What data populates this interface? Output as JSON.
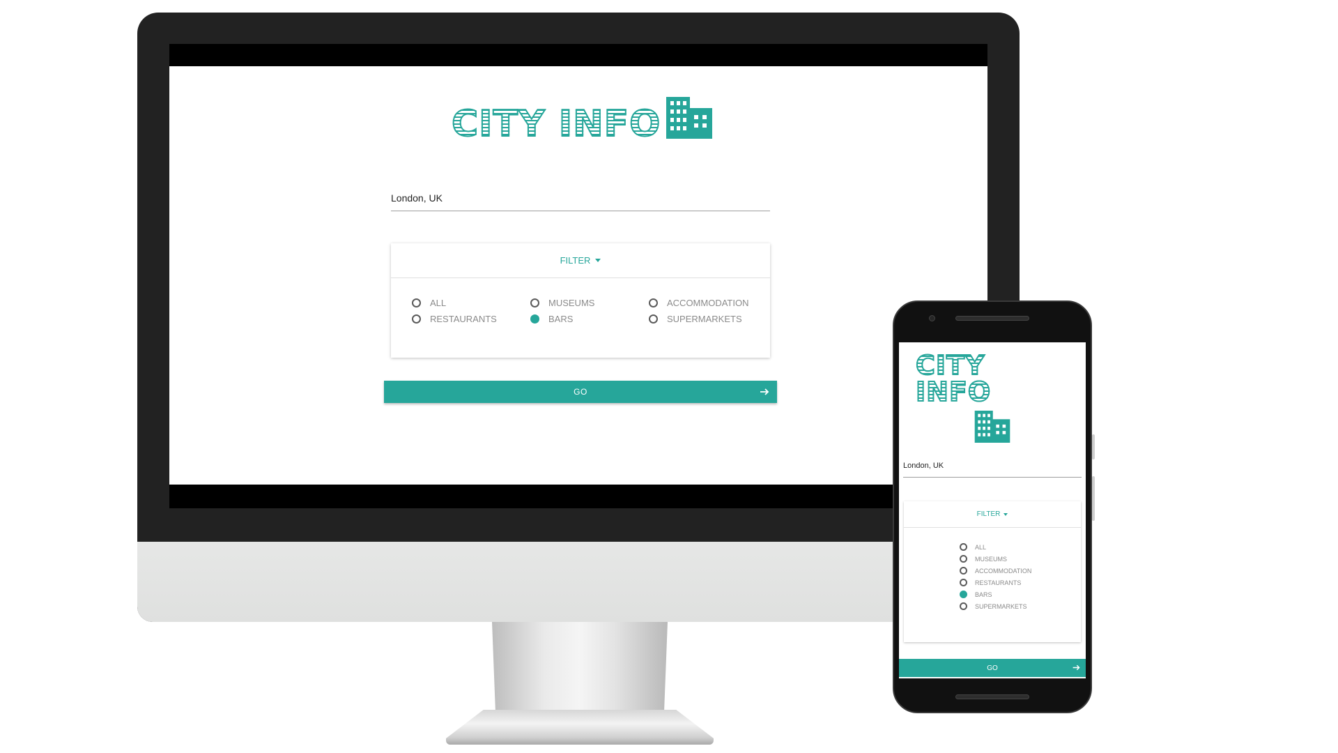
{
  "brand": {
    "logo_text": "CITY INFO",
    "accent_color": "#26a69a"
  },
  "search": {
    "value": "London, UK"
  },
  "filter": {
    "label": "FILTER",
    "options": [
      {
        "label": "ALL",
        "checked": false
      },
      {
        "label": "MUSEUMS",
        "checked": false
      },
      {
        "label": "ACCOMMODATION",
        "checked": false
      },
      {
        "label": "RESTAURANTS",
        "checked": false
      },
      {
        "label": "BARS",
        "checked": true
      },
      {
        "label": "SUPERMARKETS",
        "checked": false
      }
    ]
  },
  "go_button": {
    "label": "GO",
    "icon": "arrow-right-icon"
  },
  "devices": {
    "desktop_icon": "building-icon",
    "mobile_icon": "building-icon"
  }
}
